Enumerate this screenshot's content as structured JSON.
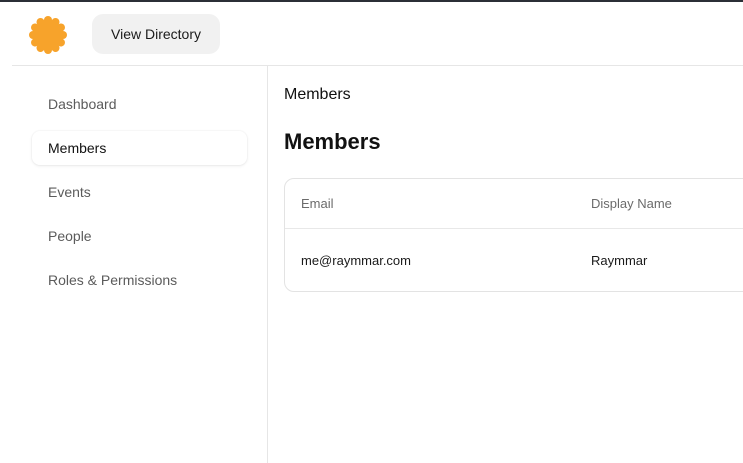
{
  "header": {
    "logo_icon": "orange-asterisk-logo-icon",
    "logo_color": "#F7A32B",
    "view_directory_label": "View Directory"
  },
  "sidebar": {
    "items": [
      {
        "label": "Dashboard",
        "active": false
      },
      {
        "label": "Members",
        "active": true
      },
      {
        "label": "Events",
        "active": false
      },
      {
        "label": "People",
        "active": false
      },
      {
        "label": "Roles & Permissions",
        "active": false
      }
    ]
  },
  "main": {
    "breadcrumb": "Members",
    "title": "Members",
    "table": {
      "columns": [
        "Email",
        "Display Name"
      ],
      "rows": [
        {
          "email": "me@raymmar.com",
          "display_name": "Raymmar"
        }
      ]
    }
  }
}
